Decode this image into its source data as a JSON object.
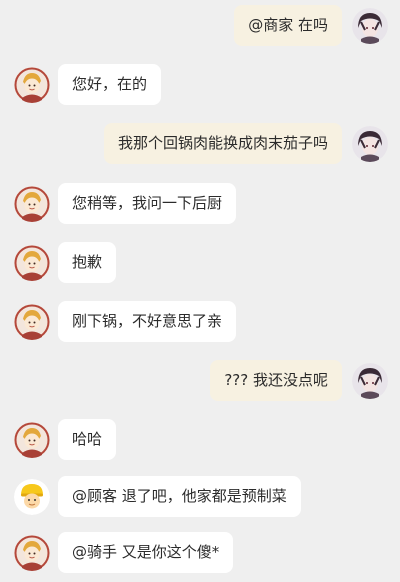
{
  "messages": [
    {
      "side": "right",
      "text": "@商家 在吗",
      "avatar": "customer-avatar"
    },
    {
      "side": "left",
      "text": "您好，在的",
      "avatar": "merchant-avatar"
    },
    {
      "side": "right",
      "text": "我那个回锅肉能换成肉末茄子吗",
      "avatar": "customer-avatar"
    },
    {
      "side": "left",
      "text": "您稍等，我问一下后厨",
      "avatar": "merchant-avatar"
    },
    {
      "side": "left",
      "text": "抱歉",
      "avatar": "merchant-avatar"
    },
    {
      "side": "left",
      "text": "刚下锅，不好意思了亲",
      "avatar": "merchant-avatar"
    },
    {
      "side": "right",
      "text": "??? 我还没点呢",
      "avatar": "customer-avatar"
    },
    {
      "side": "left",
      "text": "哈哈",
      "avatar": "merchant-avatar"
    },
    {
      "side": "left",
      "text": "@顾客 退了吧，他家都是预制菜",
      "avatar": "rider-avatar"
    },
    {
      "side": "left",
      "text": "@骑手 又是你这个傻*",
      "avatar": "merchant-avatar"
    }
  ],
  "colors": {
    "background": "#efefef",
    "incoming_bubble": "#ffffff",
    "outgoing_bubble": "#f7f1e1",
    "text": "#2b2b2b"
  }
}
